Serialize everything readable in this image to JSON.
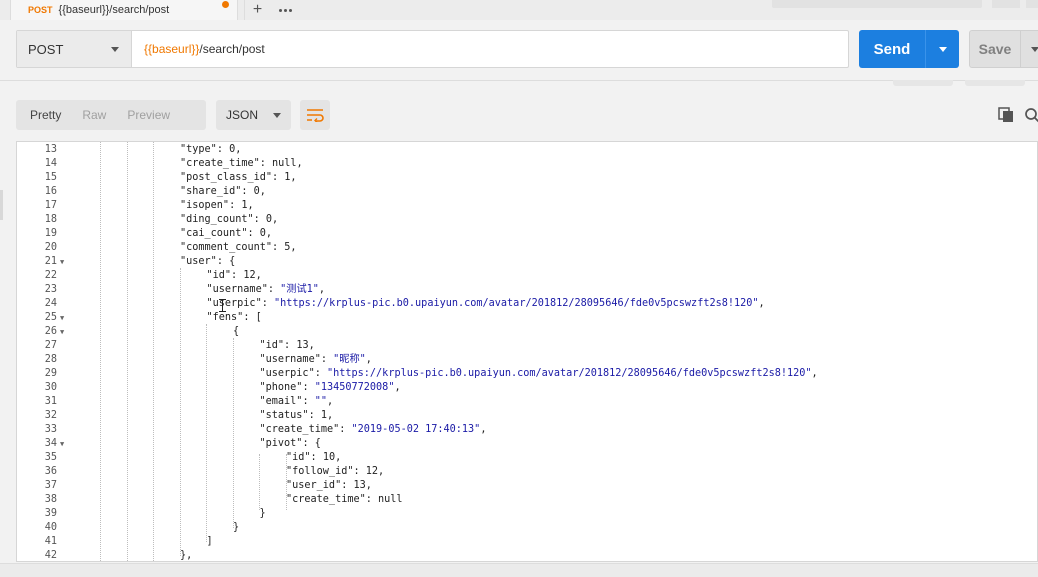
{
  "tab": {
    "method": "POST",
    "url": "{{baseurl}}/search/post"
  },
  "request": {
    "method": "POST",
    "url_variable": "{{baseurl}}",
    "url_path": "/search/post",
    "send_label": "Send",
    "save_label": "Save"
  },
  "response": {
    "views": [
      "Pretty",
      "Raw",
      "Preview"
    ],
    "active_view": "Pretty",
    "format": "JSON"
  },
  "colors": {
    "accent": "#f07800",
    "send": "#1c7fe0",
    "string": "#1a1aa6"
  },
  "code_lines": [
    {
      "n": "13",
      "indent": 3,
      "fold": false,
      "parts": [
        [
          "k",
          "\"type\""
        ],
        [
          "n",
          ": 0,"
        ]
      ]
    },
    {
      "n": "14",
      "indent": 3,
      "fold": false,
      "parts": [
        [
          "k",
          "\"create_time\""
        ],
        [
          "n",
          ": null,"
        ]
      ]
    },
    {
      "n": "15",
      "indent": 3,
      "fold": false,
      "parts": [
        [
          "k",
          "\"post_class_id\""
        ],
        [
          "n",
          ": 1,"
        ]
      ]
    },
    {
      "n": "16",
      "indent": 3,
      "fold": false,
      "parts": [
        [
          "k",
          "\"share_id\""
        ],
        [
          "n",
          ": 0,"
        ]
      ]
    },
    {
      "n": "17",
      "indent": 3,
      "fold": false,
      "parts": [
        [
          "k",
          "\"isopen\""
        ],
        [
          "n",
          ": 1,"
        ]
      ]
    },
    {
      "n": "18",
      "indent": 3,
      "fold": false,
      "parts": [
        [
          "k",
          "\"ding_count\""
        ],
        [
          "n",
          ": 0,"
        ]
      ]
    },
    {
      "n": "19",
      "indent": 3,
      "fold": false,
      "parts": [
        [
          "k",
          "\"cai_count\""
        ],
        [
          "n",
          ": 0,"
        ]
      ]
    },
    {
      "n": "20",
      "indent": 3,
      "fold": false,
      "parts": [
        [
          "k",
          "\"comment_count\""
        ],
        [
          "n",
          ": 5,"
        ]
      ]
    },
    {
      "n": "21",
      "indent": 3,
      "fold": true,
      "parts": [
        [
          "k",
          "\"user\""
        ],
        [
          "n",
          ": {"
        ]
      ]
    },
    {
      "n": "22",
      "indent": 4,
      "fold": false,
      "parts": [
        [
          "k",
          "\"id\""
        ],
        [
          "n",
          ": 12,"
        ]
      ]
    },
    {
      "n": "23",
      "indent": 4,
      "fold": false,
      "parts": [
        [
          "k",
          "\"username\""
        ],
        [
          "n",
          ": "
        ],
        [
          "s",
          "\"测试1\""
        ],
        [
          "n",
          ","
        ]
      ]
    },
    {
      "n": "24",
      "indent": 4,
      "fold": false,
      "parts": [
        [
          "k",
          "\"userpic\""
        ],
        [
          "n",
          ": "
        ],
        [
          "s",
          "\"https://krplus-pic.b0.upaiyun.com/avatar/201812/28095646/fde0v5pcswzft2s8!120\""
        ],
        [
          "n",
          ","
        ]
      ]
    },
    {
      "n": "25",
      "indent": 4,
      "fold": true,
      "parts": [
        [
          "k",
          "\"fens\""
        ],
        [
          "n",
          ": ["
        ]
      ]
    },
    {
      "n": "26",
      "indent": 5,
      "fold": true,
      "parts": [
        [
          "n",
          "{"
        ]
      ]
    },
    {
      "n": "27",
      "indent": 6,
      "fold": false,
      "parts": [
        [
          "k",
          "\"id\""
        ],
        [
          "n",
          ": 13,"
        ]
      ]
    },
    {
      "n": "28",
      "indent": 6,
      "fold": false,
      "parts": [
        [
          "k",
          "\"username\""
        ],
        [
          "n",
          ": "
        ],
        [
          "s",
          "\"昵称\""
        ],
        [
          "n",
          ","
        ]
      ]
    },
    {
      "n": "29",
      "indent": 6,
      "fold": false,
      "parts": [
        [
          "k",
          "\"userpic\""
        ],
        [
          "n",
          ": "
        ],
        [
          "s",
          "\"https://krplus-pic.b0.upaiyun.com/avatar/201812/28095646/fde0v5pcswzft2s8!120\""
        ],
        [
          "n",
          ","
        ]
      ]
    },
    {
      "n": "30",
      "indent": 6,
      "fold": false,
      "parts": [
        [
          "k",
          "\"phone\""
        ],
        [
          "n",
          ": "
        ],
        [
          "s",
          "\"13450772008\""
        ],
        [
          "n",
          ","
        ]
      ]
    },
    {
      "n": "31",
      "indent": 6,
      "fold": false,
      "parts": [
        [
          "k",
          "\"email\""
        ],
        [
          "n",
          ": "
        ],
        [
          "s",
          "\"\""
        ],
        [
          "n",
          ","
        ]
      ]
    },
    {
      "n": "32",
      "indent": 6,
      "fold": false,
      "parts": [
        [
          "k",
          "\"status\""
        ],
        [
          "n",
          ": 1,"
        ]
      ]
    },
    {
      "n": "33",
      "indent": 6,
      "fold": false,
      "parts": [
        [
          "k",
          "\"create_time\""
        ],
        [
          "n",
          ": "
        ],
        [
          "s",
          "\"2019-05-02 17:40:13\""
        ],
        [
          "n",
          ","
        ]
      ]
    },
    {
      "n": "34",
      "indent": 6,
      "fold": true,
      "parts": [
        [
          "k",
          "\"pivot\""
        ],
        [
          "n",
          ": {"
        ]
      ]
    },
    {
      "n": "35",
      "indent": 7,
      "fold": false,
      "parts": [
        [
          "k",
          "\"id\""
        ],
        [
          "n",
          ": 10,"
        ]
      ]
    },
    {
      "n": "36",
      "indent": 7,
      "fold": false,
      "parts": [
        [
          "k",
          "\"follow_id\""
        ],
        [
          "n",
          ": 12,"
        ]
      ]
    },
    {
      "n": "37",
      "indent": 7,
      "fold": false,
      "parts": [
        [
          "k",
          "\"user_id\""
        ],
        [
          "n",
          ": 13,"
        ]
      ]
    },
    {
      "n": "38",
      "indent": 7,
      "fold": false,
      "parts": [
        [
          "k",
          "\"create_time\""
        ],
        [
          "n",
          ": null"
        ]
      ]
    },
    {
      "n": "39",
      "indent": 6,
      "fold": false,
      "parts": [
        [
          "n",
          "}"
        ]
      ]
    },
    {
      "n": "40",
      "indent": 5,
      "fold": false,
      "parts": [
        [
          "n",
          "}"
        ]
      ]
    },
    {
      "n": "41",
      "indent": 4,
      "fold": false,
      "parts": [
        [
          "n",
          "]"
        ]
      ]
    },
    {
      "n": "42",
      "indent": 3,
      "fold": false,
      "parts": [
        [
          "n",
          "},"
        ]
      ]
    }
  ]
}
